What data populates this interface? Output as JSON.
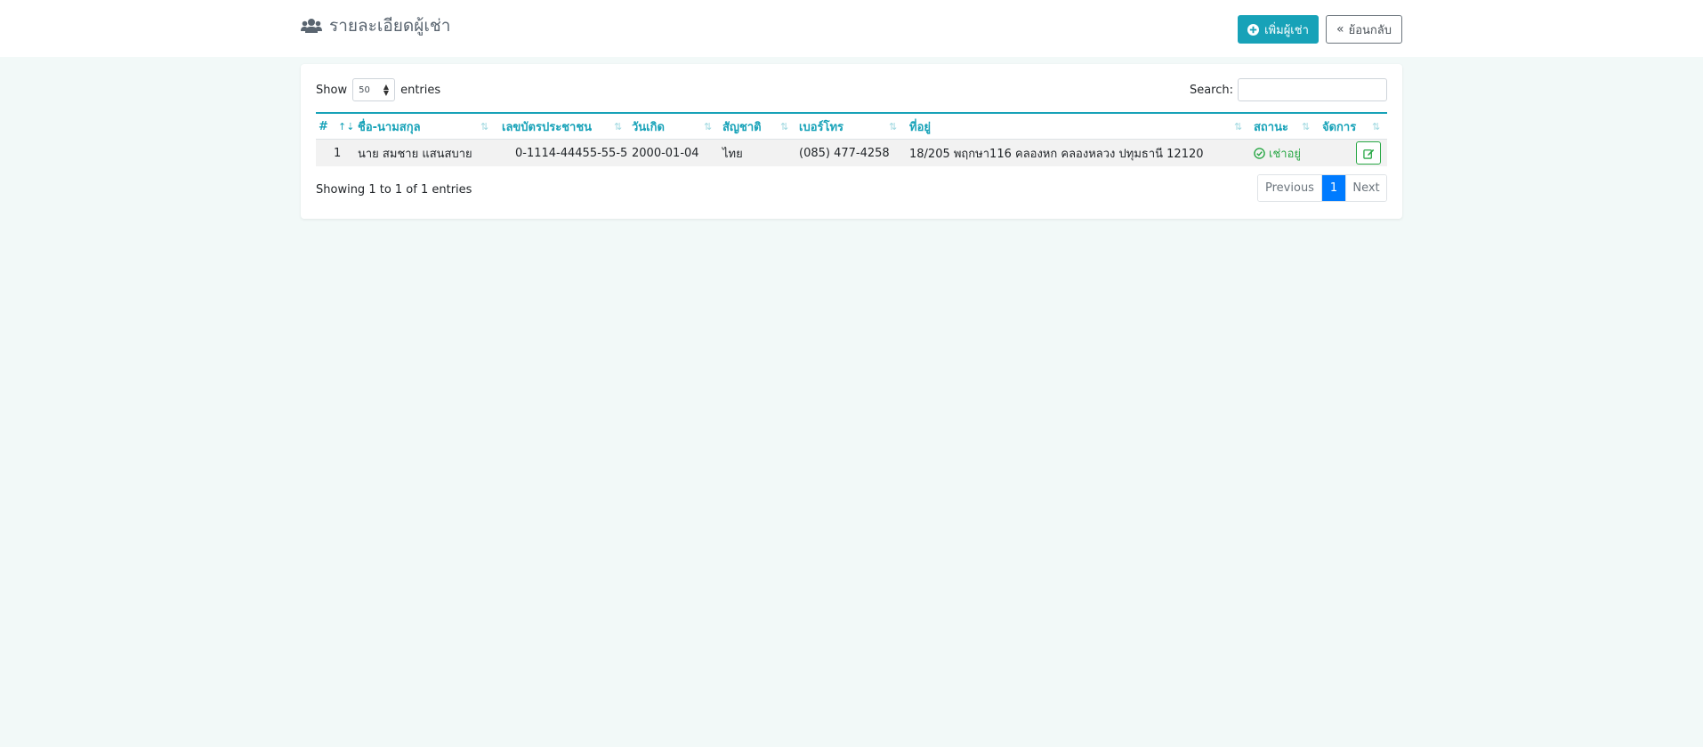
{
  "header": {
    "title": "รายละเอียดผู้เช่า",
    "add_button": "เพิ่มผู้เช่า",
    "back_button": "ย้อนกลับ"
  },
  "table_controls": {
    "show_label": "Show",
    "page_length": "50",
    "entries_label": "entries",
    "search_label": "Search:",
    "search_value": ""
  },
  "columns": [
    "#",
    "ชื่อ-นามสกุล",
    "เลขบัตรประชาชน",
    "วันเกิด",
    "สัญชาติ",
    "เบอร์โทร",
    "ที่อยู่",
    "สถานะ",
    "จัดการ"
  ],
  "rows": [
    {
      "no": "1",
      "name": "นาย สมชาย แสนสบาย",
      "id_card": "0-1114-44455-55-5",
      "birth_date": "2000-01-04",
      "nationality": "ไทย",
      "phone": "(085) 477-4258",
      "address": "18/205 พฤกษา116 คลองหก คลองหลวง ปทุมธานี 12120",
      "status": "เช่าอยู่"
    }
  ],
  "footer": {
    "info": "Showing 1 to 1 of 1 entries",
    "previous": "Previous",
    "current_page": "1",
    "next": "Next"
  },
  "colors": {
    "accent": "#17a2b8",
    "status_green": "#28a745",
    "pager_active": "#007bff",
    "page_bg": "#f2f9f8"
  },
  "icons": {
    "title": "users-icon",
    "add": "plus-circle-icon",
    "back": "double-chevron-left-icon",
    "status": "check-circle-icon",
    "edit": "edit-icon"
  }
}
